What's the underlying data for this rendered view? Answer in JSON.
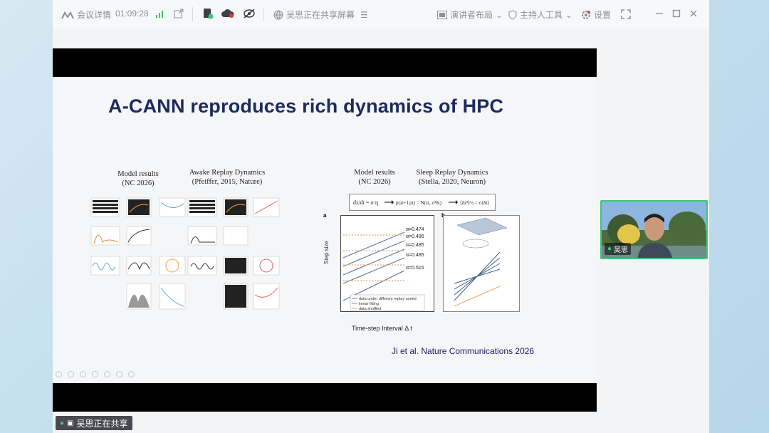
{
  "toolbar": {
    "meeting_details": "会议详情",
    "timer": "01:09:28",
    "sharer_status": "吴思正在共享屏幕",
    "speaker_layout": "演讲者布局",
    "host_tools": "主持人工具",
    "settings": "设置"
  },
  "slide": {
    "title": "A-CANN reproduces rich dynamics of HPC",
    "left_fig": {
      "model_results": "Model results",
      "model_ref": "(NC 2026)",
      "awake_title": "Awake Replay Dynamics",
      "awake_ref": "(Pfeiffer, 2015, Nature)"
    },
    "right_fig": {
      "model_results": "Model results",
      "model_ref": "(NC 2026)",
      "sleep_title": "Sleep Replay Dynamics",
      "sleep_ref": "(Stella, 2020, Neuron)",
      "panel_a": "a",
      "panel_b": "b",
      "ylabel": "Step size",
      "xlabel": "Time-step Interval  Δ t",
      "alphas": [
        "α=0.474",
        "α=0.486",
        "α=0.485",
        "α=0.485",
        "α=0.515"
      ],
      "legend": [
        "data under different replay speed",
        "linear fitting",
        "data shuffled"
      ]
    },
    "citation": "Ji et al. Nature Communications 2026"
  },
  "video": {
    "name": "吴思"
  },
  "share_tag": "吴思正在共享",
  "colors": {
    "accent": "#3cc878",
    "title": "#1c2a5c"
  }
}
